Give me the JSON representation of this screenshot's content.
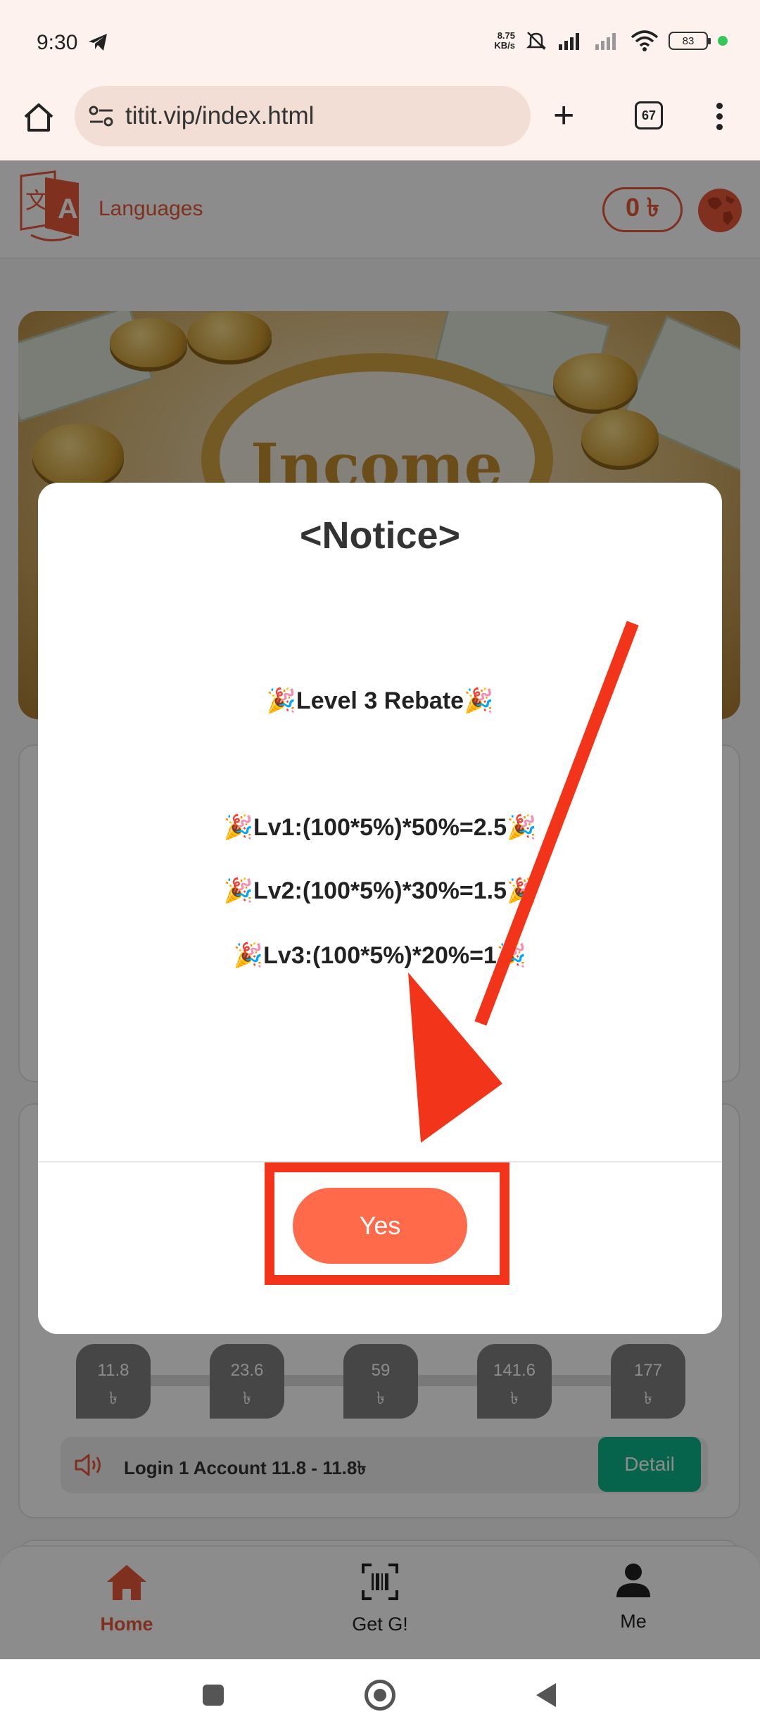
{
  "status_bar": {
    "time": "9:30",
    "net_speed_value": "8.75",
    "net_speed_unit": "KB/s",
    "battery": "83"
  },
  "browser": {
    "url": "titit.vip/index.html",
    "tab_count": "67"
  },
  "header": {
    "languages_label": "Languages",
    "balance": "0 ৳"
  },
  "banner": {
    "text": "Income"
  },
  "amount_chips": [
    {
      "value": "11.8",
      "unit": "৳"
    },
    {
      "value": "23.6",
      "unit": "৳"
    },
    {
      "value": "59",
      "unit": "৳"
    },
    {
      "value": "141.6",
      "unit": "৳"
    },
    {
      "value": "177",
      "unit": "৳"
    }
  ],
  "notice_bar": {
    "text": "Login 1 Account 11.8 - 11.8৳",
    "detail_label": "Detail"
  },
  "bottom_nav": {
    "home": "Home",
    "get": "Get G!",
    "me": "Me"
  },
  "modal": {
    "title": "<Notice>",
    "line1": "🎉Level 3 Rebate🎉",
    "line2": "🎉Lv1:(100*5%)*50%=2.5🎉",
    "line3": "🎉Lv2:(100*5%)*30%=1.5🎉",
    "line4": "🎉Lv3:(100*5%)*20%=1🎉",
    "yes_label": "Yes"
  },
  "colors": {
    "accent": "#e8583a",
    "yes_button": "#ff6a4a",
    "annotation_red": "#f2341a",
    "detail_green": "#0bb48b"
  }
}
